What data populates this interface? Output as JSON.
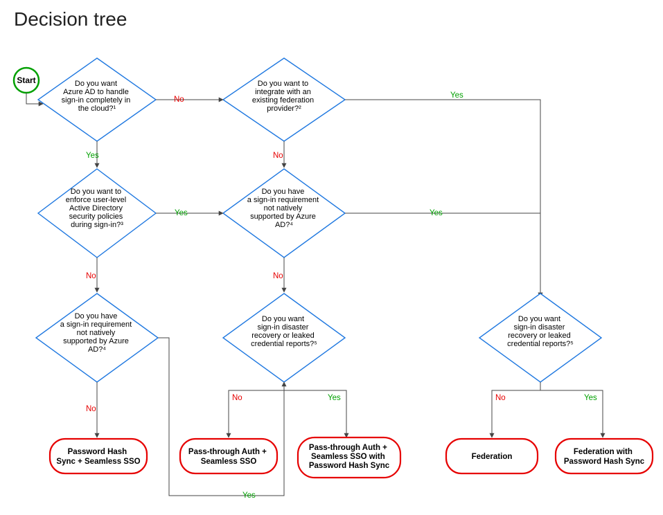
{
  "title": "Decision tree",
  "start": {
    "label": "Start"
  },
  "edges": {
    "yes": "Yes",
    "no": "No"
  },
  "nodes": {
    "q_cloud": {
      "l1": "Do you want",
      "l2": "Azure AD to handle",
      "l3": "sign-in completely in",
      "l4": "the cloud?¹"
    },
    "q_fed_provider": {
      "l1": "Do you want to",
      "l2": "integrate with an",
      "l3": "existing federation",
      "l4": "provider?²"
    },
    "q_enforce_ad": {
      "l1": "Do you want to",
      "l2": "enforce user-level",
      "l3": "Active Directory",
      "l4": "security policies",
      "l5": "during sign-in?³"
    },
    "q_not_native_1": {
      "l1": "Do you have",
      "l2": "a sign-in requirement",
      "l3": "not natively",
      "l4": "supported by Azure",
      "l5": "AD?⁴"
    },
    "q_not_native_2": {
      "l1": "Do you have",
      "l2": "a sign-in requirement",
      "l3": "not natively",
      "l4": "supported by Azure",
      "l5": "AD?⁴"
    },
    "q_dr_1": {
      "l1": "Do you want",
      "l2": "sign-in disaster",
      "l3": "recovery or leaked",
      "l4": "credential reports?⁵"
    },
    "q_dr_2": {
      "l1": "Do you want",
      "l2": "sign-in disaster",
      "l3": "recovery or leaked",
      "l4": "credential reports?⁵"
    }
  },
  "terminals": {
    "phs_sso": {
      "l1": "Password Hash",
      "l2": "Sync + Seamless SSO"
    },
    "pta_sso": {
      "l1": "Pass-through Auth +",
      "l2": "Seamless SSO"
    },
    "pta_sso_phs": {
      "l1": "Pass-through Auth +",
      "l2": "Seamless SSO with",
      "l3": "Password Hash Sync"
    },
    "fed": {
      "l1": "Federation"
    },
    "fed_phs": {
      "l1": "Federation with",
      "l2": "Password Hash Sync"
    }
  }
}
